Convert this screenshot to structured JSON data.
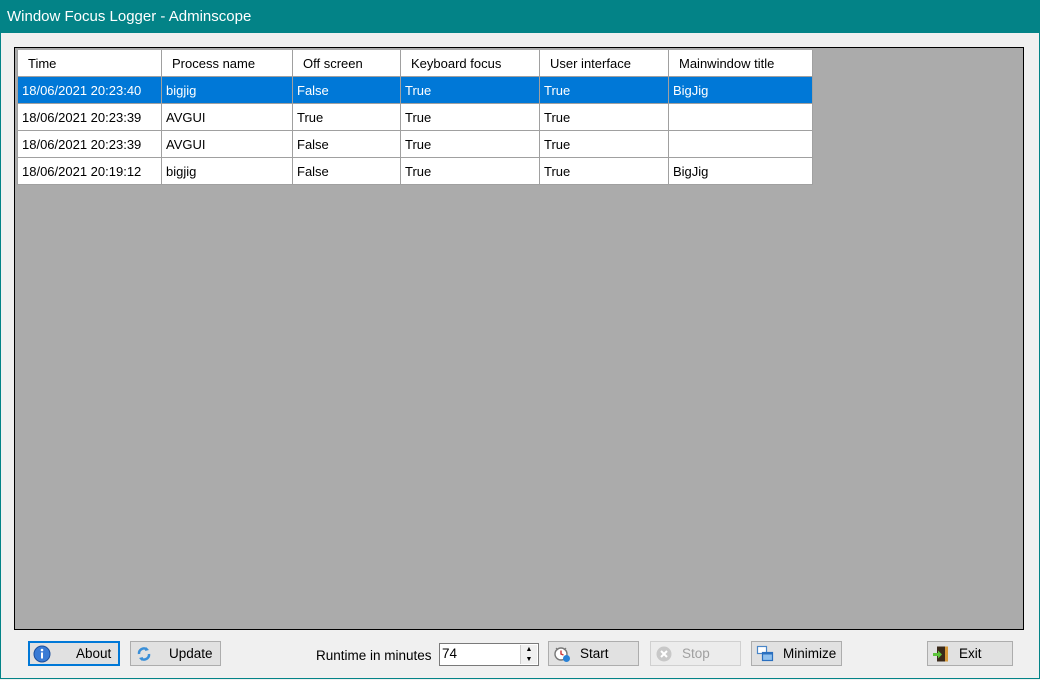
{
  "window": {
    "title": "Window Focus Logger - Adminscope"
  },
  "grid": {
    "columns": [
      "Time",
      "Process name",
      "Off screen",
      "Keyboard focus",
      "User interface",
      "Mainwindow title"
    ],
    "rows": [
      [
        "18/06/2021 20:23:40",
        "bigjig",
        "False",
        "True",
        "True",
        "BigJig"
      ],
      [
        "18/06/2021 20:23:39",
        "AVGUI",
        "True",
        "True",
        "True",
        ""
      ],
      [
        "18/06/2021 20:23:39",
        "AVGUI",
        "False",
        "True",
        "True",
        ""
      ],
      [
        "18/06/2021 20:19:12",
        "bigjig",
        "False",
        "True",
        "True",
        "BigJig"
      ]
    ],
    "selected_row": 0,
    "selection_color": "#0078d7"
  },
  "toolbar": {
    "about_label": "About",
    "update_label": "Update",
    "runtime_label": "Runtime in minutes",
    "runtime_value": "74",
    "start_label": "Start",
    "stop_label": "Stop",
    "minimize_label": "Minimize",
    "exit_label": "Exit"
  },
  "icons": {
    "about": "info-icon",
    "update": "refresh-icon",
    "start": "clock-start-icon",
    "stop": "stop-circle-icon",
    "minimize": "windows-minimize-icon",
    "exit": "exit-door-icon"
  },
  "theme": {
    "titlebar": "#038387",
    "accent": "#0078d7"
  }
}
